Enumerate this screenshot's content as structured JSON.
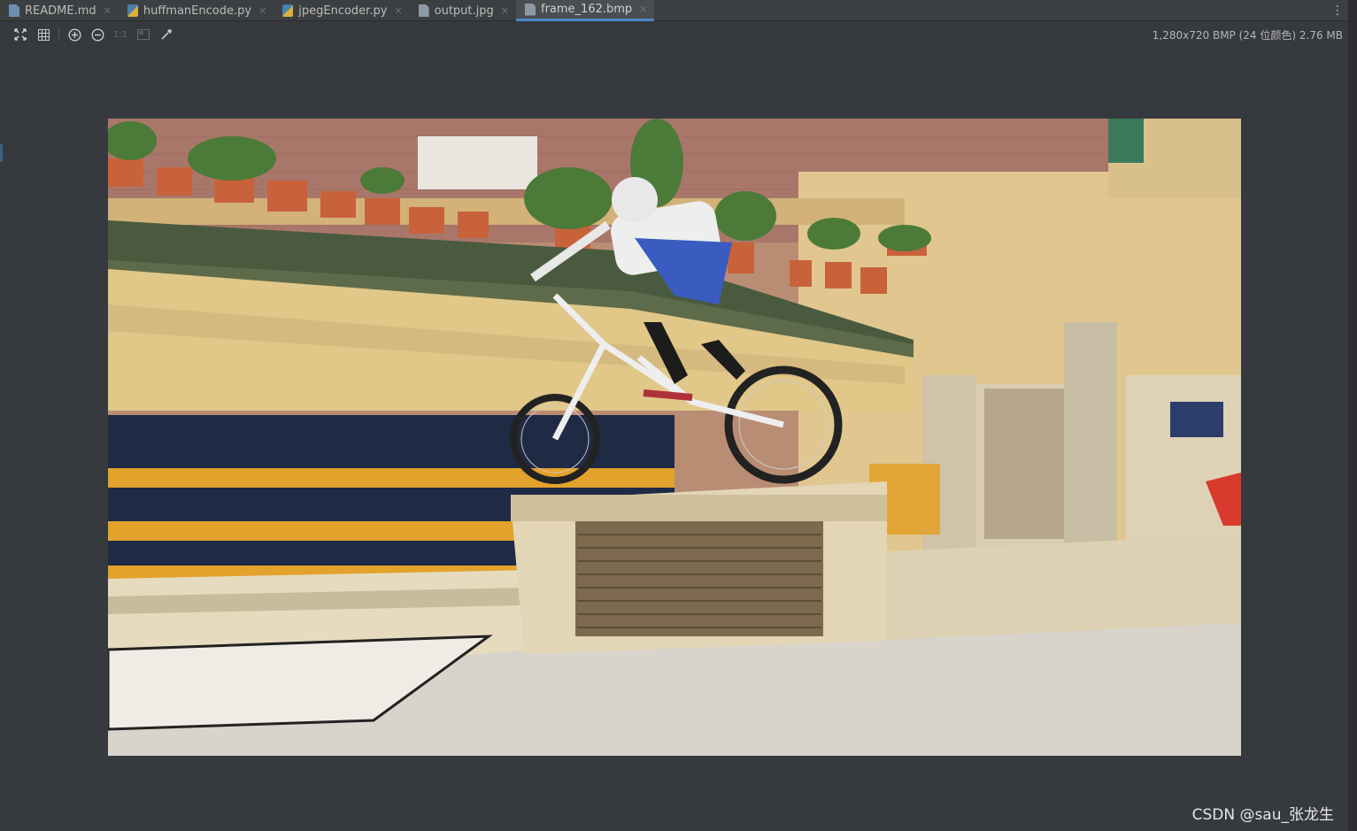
{
  "tabs": [
    {
      "label": "README.md",
      "icon": "markdown-file-icon",
      "active": false
    },
    {
      "label": "huffmanEncode.py",
      "icon": "python-file-icon",
      "active": false
    },
    {
      "label": "jpegEncoder.py",
      "icon": "python-file-icon",
      "active": false
    },
    {
      "label": "output.jpg",
      "icon": "image-file-icon",
      "active": false
    },
    {
      "label": "frame_162.bmp",
      "icon": "image-file-icon",
      "active": true
    }
  ],
  "toolbar": {
    "fit_icon": "fit-to-window-icon",
    "grid_icon": "grid-icon",
    "zoom_in_icon": "zoom-in-icon",
    "zoom_out_icon": "zoom-out-icon",
    "actual_size_label": "1:1",
    "background_icon": "background-icon",
    "color_picker_icon": "color-picker-icon"
  },
  "image_info": "1,280x720 BMP (24 位颜色) 2.76 MB",
  "watermark": "CSDN @sau_张龙生",
  "colors": {
    "accent": "#4a88c7",
    "background": "#36393d",
    "tabbar": "#3c3f41"
  }
}
